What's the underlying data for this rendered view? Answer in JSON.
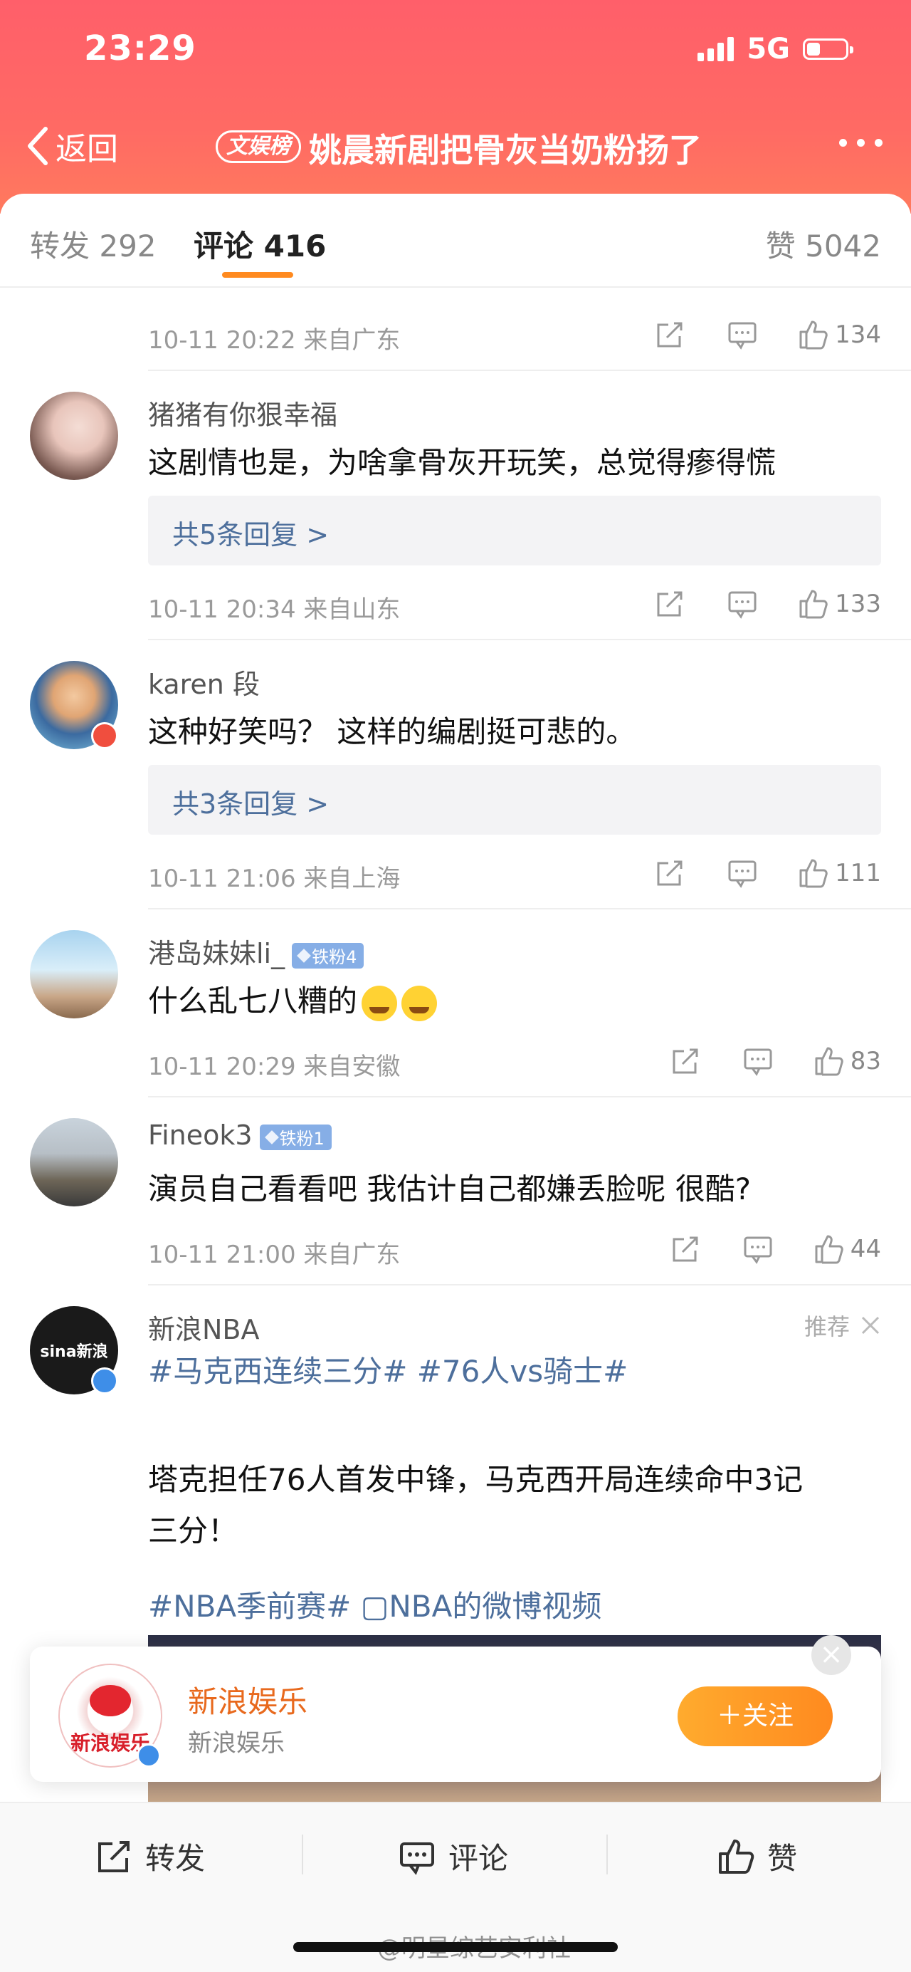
{
  "status": {
    "time": "23:29",
    "network": "5G"
  },
  "nav": {
    "back_label": "返回",
    "tag": "文娱榜",
    "title": "姚晨新剧把骨灰当奶粉扬了"
  },
  "tabs": {
    "repost": "转发 292",
    "comment": "评论 416",
    "like": "赞 5042"
  },
  "comments": [
    {
      "meta": "10-11 20:22  来自广东",
      "likes": "134"
    },
    {
      "user": "猪猪有你狠幸福",
      "text": "这剧情也是，为啥拿骨灰开玩笑，总觉得瘆得慌",
      "replies": "共5条回复 >",
      "meta": "10-11 20:34  来自山东",
      "likes": "133"
    },
    {
      "user": "karen 段",
      "text": "这种好笑吗？ 这样的编剧挺可悲的。",
      "replies": "共3条回复 >",
      "meta": "10-11 21:06  来自上海",
      "likes": "111"
    },
    {
      "user": "港岛妹妹li_",
      "badge": "铁粉4",
      "text": "什么乱七八糟的",
      "meta": "10-11 20:29  来自安徽",
      "likes": "83"
    },
    {
      "user": "Fineok3",
      "badge": "铁粉1",
      "text": "演员自己看看吧  我估计自己都嫌丢脸呢 很酷?",
      "meta": "10-11 21:00  来自广东",
      "likes": "44"
    }
  ],
  "promo": {
    "user": "新浪NBA",
    "recommend": "推荐",
    "tags": "#马克西连续三分# #76人vs骑士#",
    "body_line1": "塔克担任76人首发中锋，马克西开局连续命中3记",
    "body_line2": "三分！",
    "tags2": "#NBA季前赛# ▢NBA的微博视频",
    "avatar_text": "sina新浪"
  },
  "follow_card": {
    "title": "新浪娱乐",
    "subtitle": "新浪娱乐",
    "button": "＋关注",
    "logo_text": "新浪娱乐",
    "close": "×"
  },
  "bottom": {
    "repost": "转发",
    "comment": "评论",
    "like": "赞"
  },
  "watermark": "@明星综艺安利社",
  "colors": {
    "header": "#ff616a",
    "accent": "#ff8a1f",
    "link": "#4d6f9c",
    "badge": "#86aee6"
  }
}
